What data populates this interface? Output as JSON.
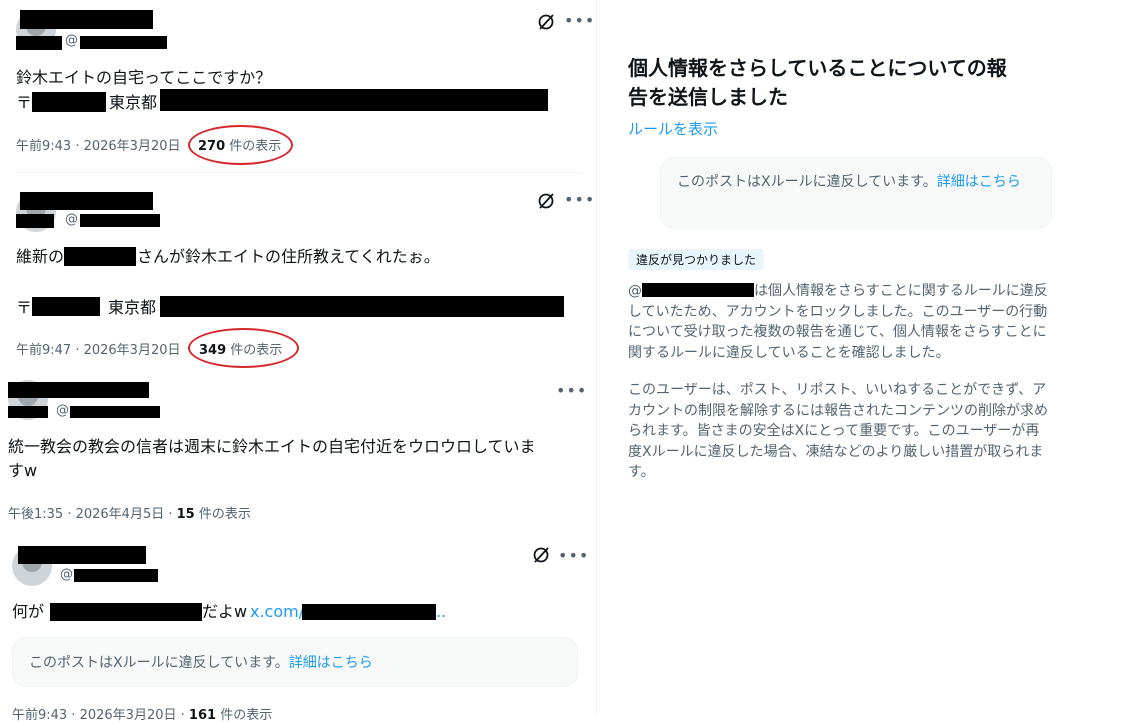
{
  "posts": [
    {
      "handle_prefix": "@",
      "line1": "鈴木エイトの自宅ってここですか？",
      "line2_prefix": "〒",
      "line2_mid": "東京都",
      "time": "午前9:43 · 2026年3月20日",
      "views_count": "270",
      "views_label": "件の表示"
    },
    {
      "handle_prefix": "@",
      "line1_prefix": "維新の",
      "line1_suffix": "さんが鈴木エイトの住所教えてくれたぉ。",
      "line2_prefix": "〒",
      "line2_mid": "東京都",
      "time": "午前9:47 · 2026年3月20日",
      "views_count": "349",
      "views_label": "件の表示"
    },
    {
      "handle_prefix": "@",
      "line1": "統一教会の教会の信者は週末に鈴木エイトの自宅付近をウロウロしていま",
      "line2": "すw",
      "time": "午後1:35 · 2026年4月5日 ·",
      "views_count": "15",
      "views_label": "件の表示"
    },
    {
      "handle_prefix": "@",
      "line1_prefix": "何が",
      "line1_mid": "だよw",
      "link_text": "x.com/",
      "link_end": "..",
      "notice_text": "このポストはXルールに違反しています。",
      "notice_link": "詳細はこちら",
      "time": "午前9:43 · 2026年3月20日 ·",
      "views_count": "161",
      "views_label": "件の表示"
    }
  ],
  "report": {
    "title_line1": "個人情報をさらしていることについての報",
    "title_line2": "告を送信しました",
    "rules_link": "ルールを表示",
    "notice_text": "このポストはXルールに違反しています。",
    "notice_link_a": "詳細はこちら",
    "notice_link_b": "ら",
    "badge": "違反が見つかりました",
    "para1": [
      "@",
      "は個人情報をさらすことに関するルールに違反",
      "していたため、アカウントをロックしました。このユーザーの行動",
      "について受け取った複数の報告を通じて、個人情報をさらすことに",
      "関するルールに違反していることを確認しました。"
    ],
    "para2": [
      "このユーザーは、ポスト、リポスト、いいねすることができず、ア",
      "カウントの制限を解除するには報告されたコンテンツの削除が求め",
      "られます。皆さまの安全はXにとって重要です。このユーザーが再",
      "度Xルールに違反した場合、凍結などのより厳しい措置が取られま",
      "す。"
    ]
  },
  "colors": {
    "accent": "#1d9bf0",
    "highlight_circle": "#d7262b",
    "badge_bg": "#e8f5fd"
  },
  "icons": [
    "grok-icon",
    "more-icon"
  ]
}
